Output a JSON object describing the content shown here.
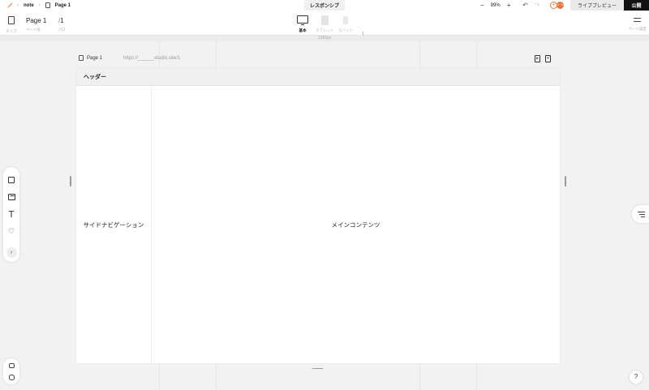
{
  "topbar": {
    "project": "note",
    "page": "Page 1",
    "mode_tab": "レスポンシブ",
    "zoom_out": "−",
    "zoom_value": "99%",
    "zoom_in": "+",
    "undo": "↶",
    "redo": "↷",
    "invite": "+",
    "avatar": "ユーザー",
    "live_preview": "ライブプレビュー",
    "publish": "公開"
  },
  "pagebar": {
    "type_caption": "タイプ",
    "page_name": "Page 1",
    "page_name_caption": "ページ名",
    "path_prefix": "/",
    "path": "1",
    "path_caption": "パス",
    "devices": [
      {
        "label": "基本"
      },
      {
        "label": "タブレット"
      },
      {
        "label": "モバイル"
      }
    ],
    "page_settings": "ページ設定",
    "width_label": "1280px"
  },
  "canvas": {
    "page_label": "Page 1",
    "url": "https://______studio.site/1",
    "header": "ヘッダー",
    "sidenav": "サイドナビゲーション",
    "main": "メインコンテンツ"
  },
  "toolbar": {
    "text_tool": "T",
    "more": "›"
  },
  "help": "?"
}
